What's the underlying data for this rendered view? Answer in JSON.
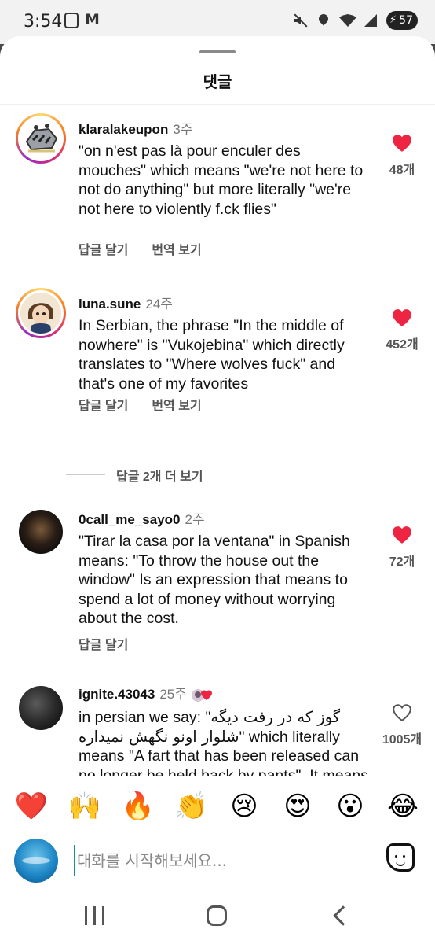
{
  "status_bar": {
    "time": "3:54",
    "battery": "57"
  },
  "sheet": {
    "title": "댓글"
  },
  "comments": [
    {
      "username": "klaralakeupon",
      "time": "3주",
      "text": "\"on n'est pas là pour enculer des mouches\" which means \"we're not here to not do anything\" but more literally \"we're not here to violently f.ck flies\"",
      "actions": [
        "답글 달기",
        "번역 보기"
      ],
      "likes": "48개",
      "liked": true
    },
    {
      "username": "luna.sune",
      "time": "24주",
      "text": "In Serbian, the phrase \"In the middle of nowhere\" is \"Vukojebina\" which directly translates to \"Where wolves fuck\" and that's one of my favorites",
      "actions": [
        "답글 달기",
        "번역 보기"
      ],
      "likes": "452개",
      "liked": true,
      "more_replies": "답글 2개 더 보기"
    },
    {
      "username": "0call_me_sayo0",
      "time": "2주",
      "text": "\"Tirar la casa por la ventana\" in Spanish means: \"To throw the house out the window\" Is an expression that means to spend a lot of money without worrying about the cost.",
      "actions": [
        "답글 달기"
      ],
      "likes": "72개",
      "liked": true
    },
    {
      "username": "ignite.43043",
      "time": "25주",
      "text_line1_prefix": "in persian we say: \"",
      "text_line1_farsi": "گوز که در رفت دیگه",
      "text_line2_farsi": "شلوار اونو نگهش نمیداره",
      "text_line2_suffix": "\" which literally",
      "text_rest": "means \"A fart that has been released can no longer be held back by pants\". It means what's done is",
      "likes": "1005개",
      "liked": false
    }
  ],
  "emoji_bar": [
    "❤️",
    "🙌",
    "🔥",
    "👏",
    "😢",
    "😍",
    "😮",
    "😂"
  ],
  "composer": {
    "placeholder": "대화를 시작해보세요..."
  },
  "colors": {
    "like_red": "#ed2442",
    "text": "#111111",
    "muted": "#555555"
  }
}
